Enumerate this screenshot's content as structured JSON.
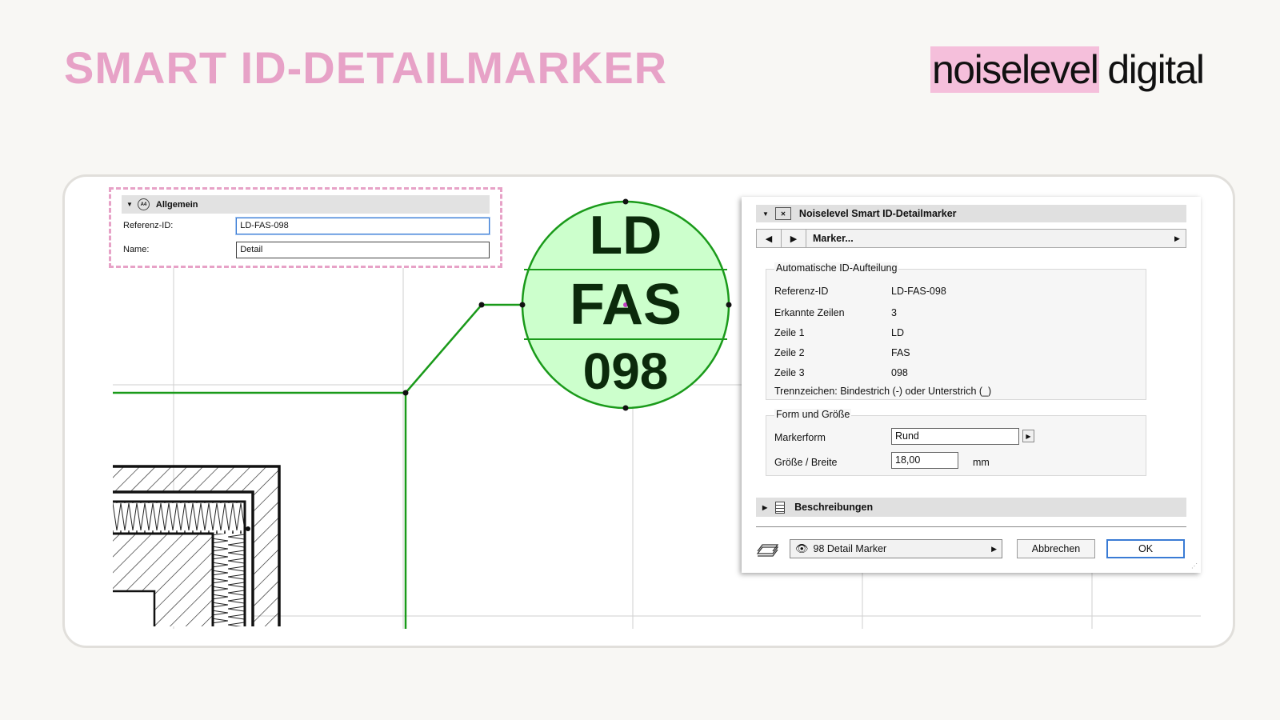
{
  "page": {
    "title": "SMART ID-DETAILMARKER",
    "brand_highlight": "noiselevel",
    "brand_rest": "digital"
  },
  "info_panel": {
    "section_title": "Allgemein",
    "section_icon_text": "A4",
    "rows": [
      {
        "label": "Referenz-ID:",
        "value": "LD-FAS-098"
      },
      {
        "label": "Name:",
        "value": "Detail"
      }
    ]
  },
  "marker": {
    "line1": "LD",
    "line2": "FAS",
    "line3": "098"
  },
  "dialog": {
    "title": "Noiselevel Smart ID-Detailmarker",
    "nav_selected": "Marker...",
    "auto_group": {
      "title": "Automatische ID-Aufteilung",
      "rows": [
        {
          "label": "Referenz-ID",
          "value": "LD-FAS-098"
        },
        {
          "label": "Erkannte Zeilen",
          "value": "3"
        },
        {
          "label": "Zeile 1",
          "value": "LD"
        },
        {
          "label": "Zeile 2",
          "value": "FAS"
        },
        {
          "label": "Zeile 3",
          "value": "098"
        }
      ],
      "note": "Trennzeichen: Bindestrich (-) oder Unterstrich (_)"
    },
    "form_group": {
      "title": "Form und Größe",
      "shape_label": "Markerform",
      "shape_value": "Rund",
      "size_label": "Größe / Breite",
      "size_value": "18,00",
      "size_unit": "mm"
    },
    "descriptions_label": "Beschreibungen",
    "layer_label": "98 Detail Marker",
    "cancel_label": "Abbrechen",
    "ok_label": "OK"
  },
  "colors": {
    "title_pink": "#e7a2c7",
    "brand_highlight": "#f5bfdb",
    "marker_fill": "#ccffcc",
    "marker_line": "#1a9a1a",
    "ok_border": "#3a7bd5"
  }
}
